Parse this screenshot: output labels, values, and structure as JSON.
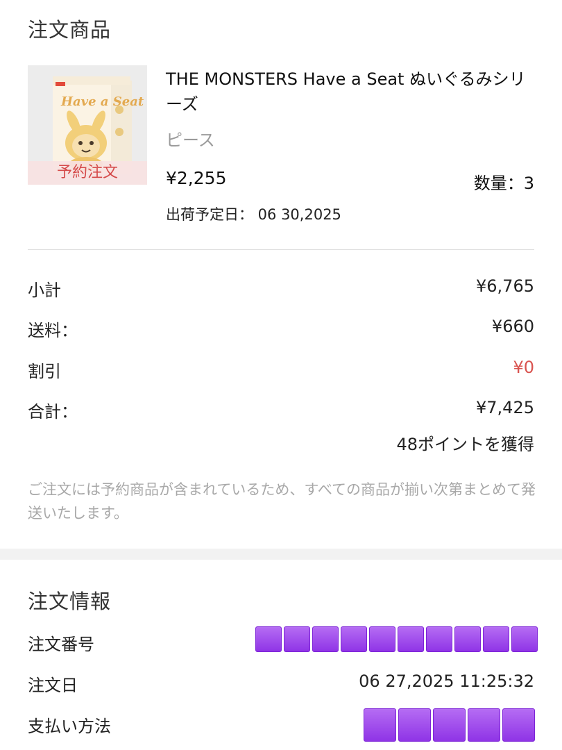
{
  "products_section": {
    "title": "注文商品",
    "item": {
      "badge": "予約注文",
      "name": "THE MONSTERS Have a Seat ぬいぐるみシリーズ",
      "variant": "ピース",
      "price": "¥2,255",
      "quantity": "数量：3",
      "ship_date": "出荷予定日：  06 30,2025",
      "thumbnail_box_text": "Have a Seat"
    }
  },
  "summary": {
    "subtotal_label": "小計",
    "subtotal_value": "¥6,765",
    "shipping_label": "送料：",
    "shipping_value": "¥660",
    "discount_label": "割引",
    "discount_value": "¥0",
    "total_label": "合計：",
    "total_value": "¥7,425",
    "points": "48ポイントを獲得",
    "note": "ご注文には予約商品が含まれているため、すべての商品が揃い次第まとめて発送いたします。"
  },
  "order_info": {
    "title": "注文情報",
    "order_number_label": "注文番号",
    "order_date_label": "注文日",
    "order_date_value": "06 27,2025 11:25:32",
    "payment_label": "支払い方法"
  },
  "colors": {
    "discount": "#d9534f",
    "badge_text": "#d54b4b",
    "redaction": "#9b44ec"
  }
}
